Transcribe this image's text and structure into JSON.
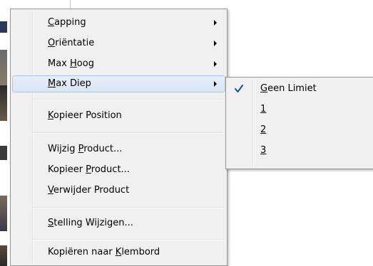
{
  "context_menu": {
    "items": [
      {
        "prefix": "",
        "mnemonic": "C",
        "suffix": "apping",
        "has_submenu": true
      },
      {
        "prefix": "",
        "mnemonic": "O",
        "suffix": "riëntatie",
        "has_submenu": true
      },
      {
        "prefix": "Max ",
        "mnemonic": "H",
        "suffix": "oog",
        "has_submenu": true
      },
      {
        "prefix": "",
        "mnemonic": "M",
        "suffix": "ax Diep",
        "has_submenu": true,
        "highlighted": true
      },
      {
        "prefix": "",
        "mnemonic": "K",
        "suffix": "opieer Position",
        "has_submenu": false
      },
      {
        "prefix": "Wijzig ",
        "mnemonic": "P",
        "suffix": "roduct...",
        "has_submenu": false
      },
      {
        "prefix": "Kopieer ",
        "mnemonic": "P",
        "suffix": "roduct...",
        "has_submenu": false
      },
      {
        "prefix": "",
        "mnemonic": "V",
        "suffix": "erwijder Product",
        "has_submenu": false
      },
      {
        "prefix": "",
        "mnemonic": "S",
        "suffix": "telling Wijzigen...",
        "has_submenu": false
      },
      {
        "prefix": "Kopiëren naar ",
        "mnemonic": "K",
        "suffix": "lembord",
        "has_submenu": false
      }
    ]
  },
  "submenu_max_diep": {
    "items": [
      {
        "prefix": "",
        "mnemonic": "G",
        "suffix": "een Limiet",
        "checked": true
      },
      {
        "prefix": "",
        "mnemonic": "1",
        "suffix": "",
        "checked": false
      },
      {
        "prefix": "",
        "mnemonic": "2",
        "suffix": "",
        "checked": false
      },
      {
        "prefix": "",
        "mnemonic": "3",
        "suffix": "",
        "checked": false
      }
    ]
  },
  "icons": {
    "submenu_arrow": "chevron-right-icon",
    "check": "checkmark-icon"
  },
  "colors": {
    "menu_background": "#f0f0f0",
    "highlight_border": "#a8c8e8",
    "highlight_fill": "#dde9f7",
    "check_color": "#1c4f9c"
  }
}
